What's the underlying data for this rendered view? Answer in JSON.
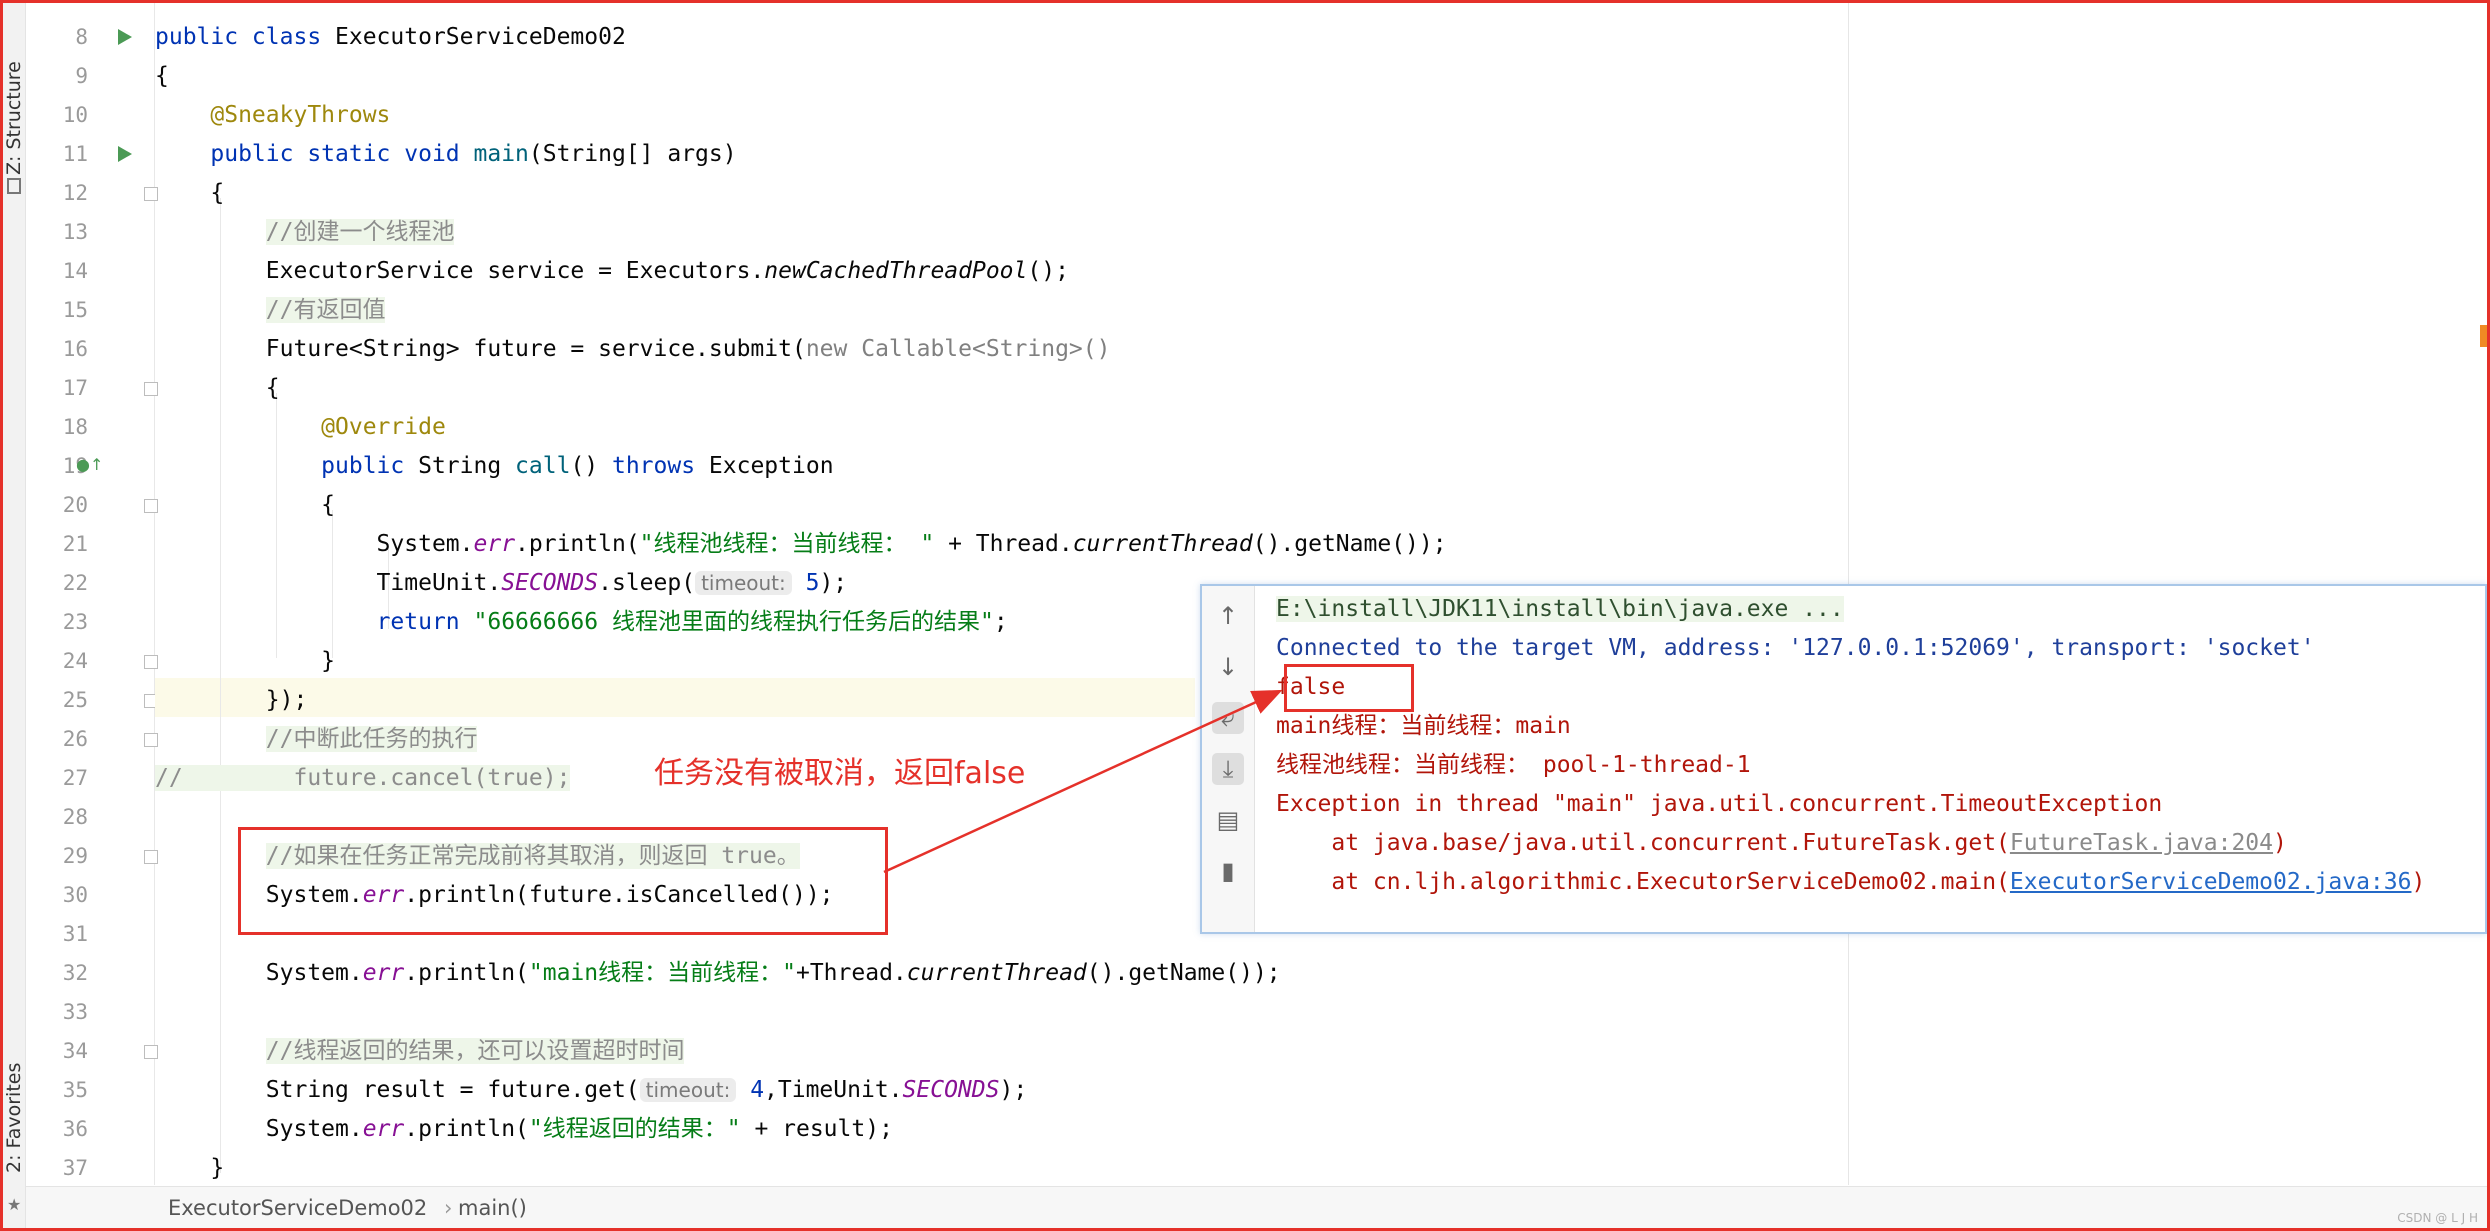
{
  "sidebar": {
    "structure_label": "Z: Structure",
    "favorites_label": "2: Favorites"
  },
  "code_lines": [
    {
      "num": "8",
      "segments": [
        {
          "t": "public class ",
          "c": "kw"
        },
        {
          "t": "ExecutorServiceDemo02",
          "c": ""
        }
      ]
    },
    {
      "num": "9",
      "segments": [
        {
          "t": "{",
          "c": ""
        }
      ]
    },
    {
      "num": "10",
      "segments": [
        {
          "t": "    ",
          "c": ""
        },
        {
          "t": "@SneakyThrows",
          "c": "ann"
        }
      ]
    },
    {
      "num": "11",
      "segments": [
        {
          "t": "    ",
          "c": ""
        },
        {
          "t": "public static void ",
          "c": "kw"
        },
        {
          "t": "main",
          "c": "mdecl"
        },
        {
          "t": "(String[] args)",
          "c": ""
        }
      ]
    },
    {
      "num": "12",
      "segments": [
        {
          "t": "    {",
          "c": ""
        }
      ]
    },
    {
      "num": "13",
      "segments": [
        {
          "t": "        ",
          "c": ""
        },
        {
          "t": "//创建一个线程池",
          "c": "cmtz"
        }
      ]
    },
    {
      "num": "14",
      "segments": [
        {
          "t": "        ExecutorService service = Executors.",
          "c": ""
        },
        {
          "t": "newCachedThreadPool",
          "c": "it"
        },
        {
          "t": "();",
          "c": ""
        }
      ]
    },
    {
      "num": "15",
      "segments": [
        {
          "t": "        ",
          "c": ""
        },
        {
          "t": "//有返回值",
          "c": "cmtz"
        }
      ]
    },
    {
      "num": "16",
      "segments": [
        {
          "t": "        Future<String> future = service.submit(",
          "c": ""
        },
        {
          "t": "new Callable<String>()",
          "c": "grey"
        }
      ]
    },
    {
      "num": "17",
      "segments": [
        {
          "t": "        {",
          "c": ""
        }
      ]
    },
    {
      "num": "18",
      "segments": [
        {
          "t": "            ",
          "c": ""
        },
        {
          "t": "@Override",
          "c": "ann"
        }
      ]
    },
    {
      "num": "19",
      "segments": [
        {
          "t": "            ",
          "c": ""
        },
        {
          "t": "public ",
          "c": "kw"
        },
        {
          "t": "String ",
          "c": ""
        },
        {
          "t": "call",
          "c": "mdecl"
        },
        {
          "t": "() ",
          "c": ""
        },
        {
          "t": "throws ",
          "c": "kw"
        },
        {
          "t": "Exception",
          "c": ""
        }
      ]
    },
    {
      "num": "20",
      "segments": [
        {
          "t": "            {",
          "c": ""
        }
      ]
    },
    {
      "num": "21",
      "segments": [
        {
          "t": "                System.",
          "c": ""
        },
        {
          "t": "err",
          "c": "field"
        },
        {
          "t": ".println(",
          "c": ""
        },
        {
          "t": "\"线程池线程：当前线程： \"",
          "c": "str"
        },
        {
          "t": " + Thread.",
          "c": ""
        },
        {
          "t": "currentThread",
          "c": "it"
        },
        {
          "t": "().getName());",
          "c": ""
        }
      ]
    },
    {
      "num": "22",
      "segments": [
        {
          "t": "                TimeUnit.",
          "c": ""
        },
        {
          "t": "SECONDS",
          "c": "field"
        },
        {
          "t": ".sleep(",
          "c": ""
        },
        {
          "t": "timeout:",
          "c": "hint"
        },
        {
          "t": " 5",
          "c": "kw"
        },
        {
          "t": ");",
          "c": ""
        }
      ]
    },
    {
      "num": "23",
      "segments": [
        {
          "t": "                ",
          "c": ""
        },
        {
          "t": "return ",
          "c": "kw"
        },
        {
          "t": "\"66666666 线程池里面的线程执行任务后的结果\"",
          "c": "str"
        },
        {
          "t": ";",
          "c": ""
        }
      ]
    },
    {
      "num": "24",
      "segments": [
        {
          "t": "            }",
          "c": ""
        }
      ]
    },
    {
      "num": "25",
      "segments": [
        {
          "t": "        });",
          "c": ""
        }
      ]
    },
    {
      "num": "26",
      "segments": [
        {
          "t": "        ",
          "c": ""
        },
        {
          "t": "//中断此任务的执行",
          "c": "cmtz"
        }
      ]
    },
    {
      "num": "27",
      "segments": [
        {
          "t": "//        future.cancel(true);",
          "c": "cmtz"
        }
      ]
    },
    {
      "num": "28",
      "segments": [
        {
          "t": "",
          "c": ""
        }
      ]
    },
    {
      "num": "29",
      "segments": [
        {
          "t": "        ",
          "c": ""
        },
        {
          "t": "//如果在任务正常完成前将其取消，则返回 true。",
          "c": "cmtz"
        }
      ]
    },
    {
      "num": "30",
      "segments": [
        {
          "t": "        System.",
          "c": ""
        },
        {
          "t": "err",
          "c": "field"
        },
        {
          "t": ".println(future.isCancelled());",
          "c": ""
        }
      ]
    },
    {
      "num": "31",
      "segments": [
        {
          "t": "",
          "c": ""
        }
      ]
    },
    {
      "num": "32",
      "segments": [
        {
          "t": "        System.",
          "c": ""
        },
        {
          "t": "err",
          "c": "field"
        },
        {
          "t": ".println(",
          "c": ""
        },
        {
          "t": "\"main线程：当前线程：\"",
          "c": "str"
        },
        {
          "t": "+Thread.",
          "c": ""
        },
        {
          "t": "currentThread",
          "c": "it"
        },
        {
          "t": "().getName());",
          "c": ""
        }
      ]
    },
    {
      "num": "33",
      "segments": [
        {
          "t": "",
          "c": ""
        }
      ]
    },
    {
      "num": "34",
      "segments": [
        {
          "t": "        ",
          "c": ""
        },
        {
          "t": "//线程返回的结果，还可以设置超时时间",
          "c": "cmtz"
        }
      ]
    },
    {
      "num": "35",
      "segments": [
        {
          "t": "        String result = future.get(",
          "c": ""
        },
        {
          "t": "timeout:",
          "c": "hint"
        },
        {
          "t": " 4",
          "c": "kw"
        },
        {
          "t": ",TimeUnit.",
          "c": ""
        },
        {
          "t": "SECONDS",
          "c": "field"
        },
        {
          "t": ");",
          "c": ""
        }
      ]
    },
    {
      "num": "36",
      "segments": [
        {
          "t": "        System.",
          "c": ""
        },
        {
          "t": "err",
          "c": "field"
        },
        {
          "t": ".println(",
          "c": ""
        },
        {
          "t": "\"线程返回的结果：\"",
          "c": "str"
        },
        {
          "t": " + result);",
          "c": ""
        }
      ]
    },
    {
      "num": "37",
      "segments": [
        {
          "t": "    }",
          "c": ""
        }
      ]
    }
  ],
  "breadcrumb": {
    "class_name": "ExecutorServiceDemo02",
    "method_name": "main()"
  },
  "annotation": {
    "callout_text": "任务没有被取消，返回false"
  },
  "console": {
    "lines": [
      {
        "segments": [
          {
            "t": "E:\\install\\JDK11\\install\\bin\\java.exe ...",
            "c": "c-cmd"
          }
        ]
      },
      {
        "segments": [
          {
            "t": "Connected to the target VM, address: '127.0.0.1:52069', transport: 'socket'",
            "c": "c-blue"
          }
        ]
      },
      {
        "segments": [
          {
            "t": "false",
            "c": "c-red"
          }
        ]
      },
      {
        "segments": [
          {
            "t": "main线程：当前线程：main",
            "c": "c-red"
          }
        ]
      },
      {
        "segments": [
          {
            "t": "线程池线程：当前线程： pool-1-thread-1",
            "c": "c-red"
          }
        ]
      },
      {
        "segments": [
          {
            "t": "Exception in thread \"main\" java.util.concurrent.TimeoutException",
            "c": "c-red"
          }
        ]
      },
      {
        "segments": [
          {
            "t": "    at java.base/java.util.concurrent.FutureTask.get(",
            "c": "c-red"
          },
          {
            "t": "FutureTask.java:204",
            "c": "c-greylink"
          },
          {
            "t": ")",
            "c": "c-red"
          }
        ]
      },
      {
        "segments": [
          {
            "t": "    at cn.ljh.algorithmic.ExecutorServiceDemo02.main(",
            "c": "c-red"
          },
          {
            "t": "ExecutorServiceDemo02.java:36",
            "c": "c-link"
          },
          {
            "t": ")",
            "c": "c-red"
          }
        ]
      }
    ],
    "toolbar": [
      "up-arrow-icon",
      "down-arrow-icon",
      "soft-wrap-icon",
      "scroll-to-end-icon",
      "print-icon",
      "trash-icon"
    ]
  },
  "watermark": "CSDN @ L J H",
  "colors": {
    "annotation_red": "#e5312a",
    "keyword": "#0033b3",
    "string": "#067d17",
    "console_error": "#b1150a"
  }
}
